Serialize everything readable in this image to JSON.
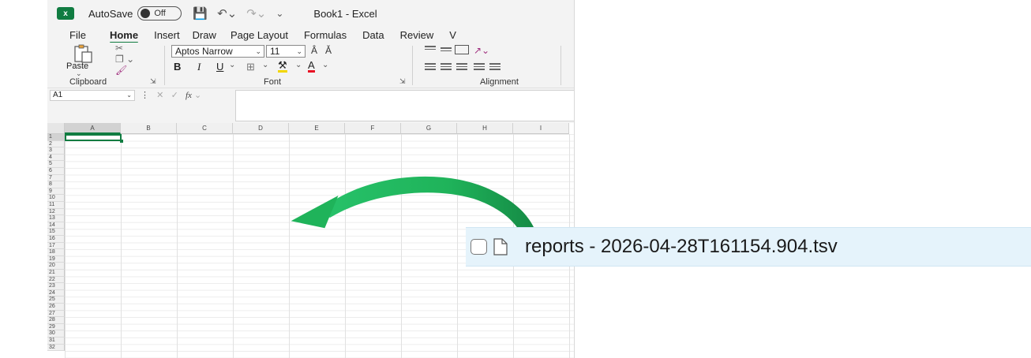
{
  "titlebar": {
    "autosave_label": "AutoSave",
    "autosave_state": "Off",
    "document_title": "Book1  -  Excel"
  },
  "tabs": [
    "File",
    "Home",
    "Insert",
    "Draw",
    "Page Layout",
    "Formulas",
    "Data",
    "Review",
    "V"
  ],
  "ribbon": {
    "clipboard": {
      "paste_label": "Paste",
      "group_label": "Clipboard"
    },
    "font": {
      "font_name": "Aptos Narrow",
      "font_size": "11",
      "group_label": "Font",
      "bold": "B",
      "italic": "I",
      "underline": "U"
    },
    "alignment": {
      "group_label": "Alignment"
    }
  },
  "formula_bar": {
    "name_box": "A1",
    "fx": "fx"
  },
  "sheet": {
    "columns": [
      "A",
      "B",
      "C",
      "D",
      "E",
      "F",
      "G",
      "H",
      "I"
    ],
    "rows": [
      "1",
      "2",
      "3",
      "4",
      "5",
      "6",
      "7",
      "8",
      "9",
      "10",
      "11",
      "12",
      "13",
      "14",
      "15",
      "16",
      "17",
      "18",
      "19",
      "20",
      "21",
      "22",
      "23",
      "24",
      "25",
      "26",
      "27",
      "28",
      "29",
      "30",
      "31",
      "32"
    ],
    "active_cell": "A1"
  },
  "file_item": {
    "name": "reports - 2026-04-28T161154.904.tsv"
  },
  "colors": {
    "excel_green": "#107c41",
    "arrow_green": "#1fb35a",
    "selection_blue": "#e5f3fb"
  }
}
